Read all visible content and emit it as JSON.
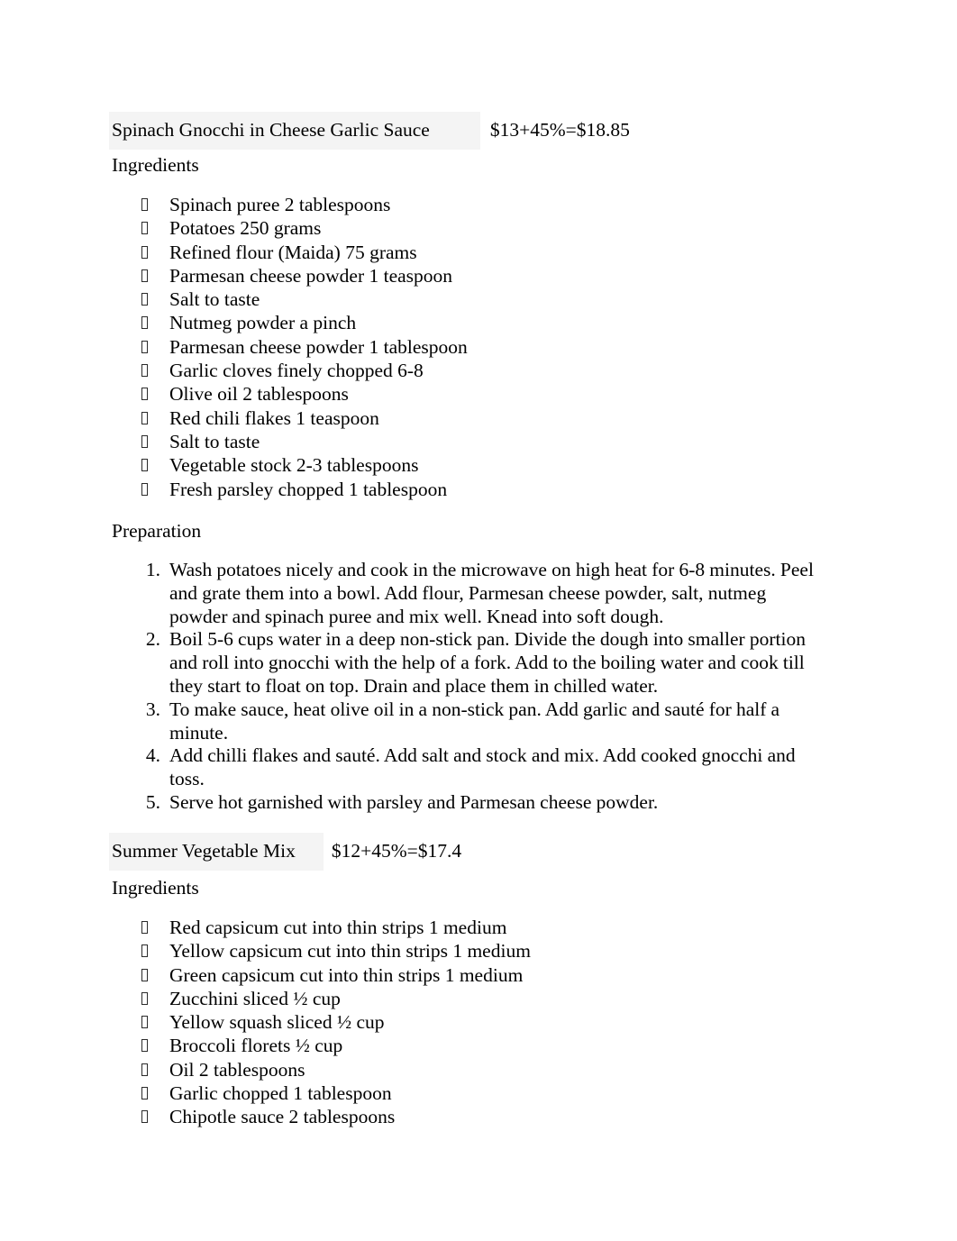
{
  "document": {
    "recipes": [
      {
        "title": "Spinach Gnocchi in Cheese Garlic Sauce",
        "price": "$13+45%=$18.85",
        "ingredients_heading": "Ingredients",
        "ingredients": [
          "Spinach puree 2 tablespoons",
          "Potatoes 250 grams",
          "Refined flour (Maida) 75 grams",
          "Parmesan cheese powder 1 teaspoon",
          "Salt to taste",
          "Nutmeg powder a pinch",
          "Parmesan cheese powder 1 tablespoon",
          "Garlic cloves finely chopped 6-8",
          "Olive oil 2 tablespoons",
          "Red chili flakes 1 teaspoon",
          "Salt to taste",
          "Vegetable stock 2-3 tablespoons",
          "Fresh parsley chopped 1 tablespoon"
        ],
        "preparation_heading": "Preparation",
        "preparation": [
          {
            "number": "1.",
            "text": "Wash potatoes nicely and cook in the microwave on high heat for 6-8 minutes. Peel and grate them into a bowl. Add flour, Parmesan cheese powder, salt, nutmeg powder and spinach puree and mix well. Knead into soft dough."
          },
          {
            "number": "2.",
            "text": "Boil 5-6 cups water in a deep non-stick pan. Divide the dough into smaller portion and roll into gnocchi with the help of a fork. Add to the boiling water and cook till they start to float on top. Drain and place them in chilled water."
          },
          {
            "number": "3.",
            "text": "To make sauce, heat olive oil in a non-stick pan. Add garlic and sauté for half a minute."
          },
          {
            "number": "4.",
            "text": "Add chilli flakes and sauté. Add salt and stock and mix. Add cooked gnocchi and toss."
          },
          {
            "number": "5.",
            "text": "Serve hot garnished with parsley and Parmesan cheese powder."
          }
        ]
      },
      {
        "title": "Summer Vegetable Mix",
        "price": "$12+45%=$17.4",
        "ingredients_heading": "Ingredients",
        "ingredients": [
          "Red capsicum cut into thin strips 1 medium",
          "Yellow capsicum cut into thin strips 1 medium",
          "Green capsicum cut into thin strips 1 medium",
          "Zucchini sliced ½ cup",
          "Yellow squash sliced ½ cup",
          "Broccoli florets ½ cup",
          "Oil 2 tablespoons",
          "Garlic chopped 1 tablespoon",
          "Chipotle sauce 2 tablespoons"
        ]
      }
    ],
    "colors": {
      "page_background": "#ffffff",
      "text": "#000000",
      "title_shading": "#f4f4f4"
    }
  }
}
